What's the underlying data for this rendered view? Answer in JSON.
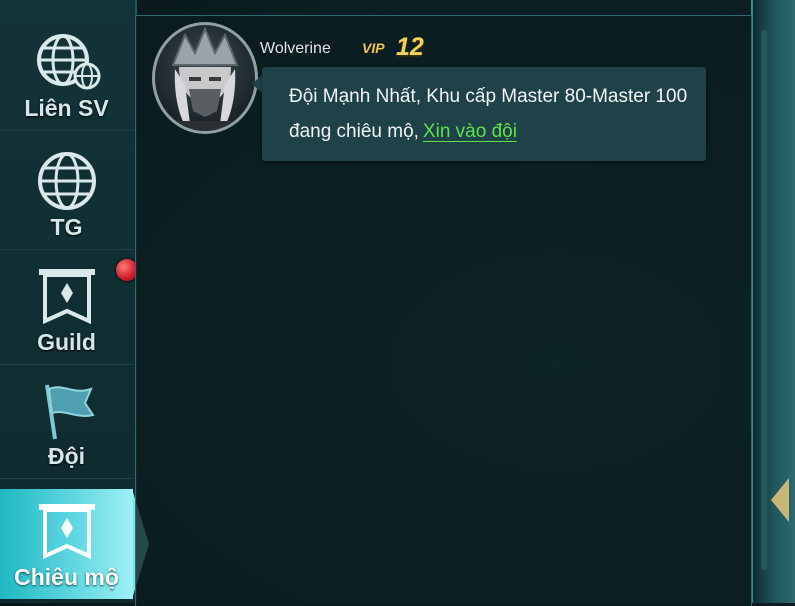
{
  "sidebar": {
    "tabs": [
      {
        "label": "Liên SV",
        "icon": "globe-server-icon",
        "active": false
      },
      {
        "label": "TG",
        "icon": "globe-icon",
        "active": false
      },
      {
        "label": "Guild",
        "icon": "guild-banner-icon",
        "active": false
      },
      {
        "label": "Đội",
        "icon": "team-flag-icon",
        "active": false
      },
      {
        "label": "Chiêu mộ",
        "icon": "recruit-banner-icon",
        "active": true
      }
    ],
    "notification_dot": true
  },
  "chat": {
    "message": {
      "sender": "Wolverine",
      "vip_badge": "VIP",
      "vip_level": "12",
      "text_line1": "Đội Mạnh Nhất, Khu cấp Master 80-Master 100",
      "text_line2": "đang chiêu mộ,",
      "join_link": "Xin vào đội"
    }
  },
  "colors": {
    "active_tab": "#5fd6e0",
    "vip": "#f3d25a",
    "link": "#5fe04a",
    "bubble": "#1f4248"
  }
}
